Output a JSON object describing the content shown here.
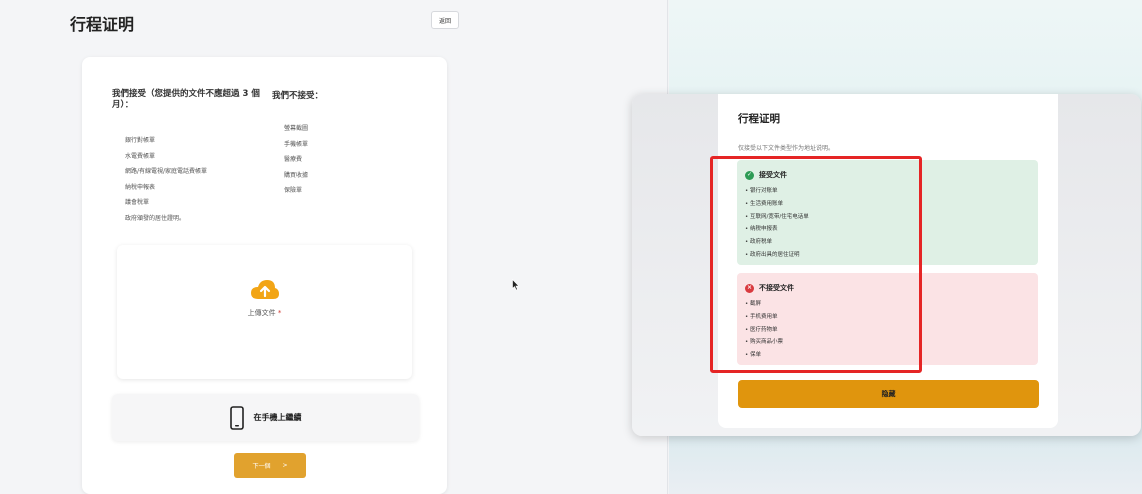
{
  "page": {
    "title": "行程证明",
    "back_label": "返回"
  },
  "documents": {
    "accept_title": "我們接受（您提供的文件不應超過 3 個月）：",
    "reject_title": "我們不接受：",
    "accepted": [
      "銀行對帳單",
      "水電費帳單",
      "網路/有線電視/家庭電話費帳單",
      "納稅申報表",
      "議會稅單",
      "政府頒發的居住證明。"
    ],
    "rejected": [
      "螢幕截圖",
      "手機帳單",
      "醫療費",
      "購買收據",
      "保險單"
    ]
  },
  "upload": {
    "icon": "cloud-upload-icon",
    "label": "上傳文件",
    "required_mark": "*"
  },
  "mobile": {
    "icon": "mobile-phone-icon",
    "label": "在手機上繼續"
  },
  "next": {
    "label": "下一個",
    "arrow": ">"
  },
  "modal": {
    "title": "行程证明",
    "description": "仅接受以下文件类型作为地址说明。",
    "accepted_title": "接受文件",
    "accepted": [
      "银行对账单",
      "生活费用账单",
      "互联网/宽带/住宅电话单",
      "纳税申报表",
      "政府税单",
      "政府出具的居住证明"
    ],
    "rejected_title": "不接受文件",
    "rejected": [
      "截屏",
      "手机费用单",
      "医疗药物单",
      "购买商品小票",
      "保单"
    ],
    "close_label": "隐藏"
  },
  "colors": {
    "accent": "#e1a22e",
    "modal_button": "#e0950d",
    "accept_bg": "#dff0e5",
    "reject_bg": "#fbe3e5",
    "highlight": "#e52525",
    "ok_badge": "#2d9b55",
    "no_badge": "#d93a3f"
  }
}
